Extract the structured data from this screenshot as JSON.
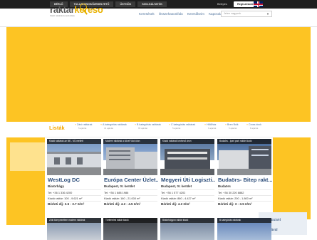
{
  "topbar": {
    "nav": [
      "BÉRLŐ",
      "TULAJDONOS/ÜZEMELTETŐ",
      "ÜGYNÖK",
      "SZOLGÁLTATÓK"
    ],
    "login": "Belépés",
    "register": "Regisztráció"
  },
  "header": {
    "logo_part1": "raktar",
    "logo_part2": "kereso",
    "logo_suffix": ".info",
    "tagline": "Kiadó raktárak keresőoldala",
    "nav": [
      "Keresések",
      "Összehasonlítás",
      "Keresőkeim",
      "Kapcsolat"
    ],
    "select_placeholder": "Jelen vagyunk"
  },
  "lists": {
    "title": "Listák",
    "categories": [
      {
        "label": "Záró raktárak",
        "count": "5 ajánlat"
      },
      {
        "label": "A kategóriás raktárak",
        "count": "31 ajánlat"
      },
      {
        "label": "B kategóriás raktárak",
        "count": "65 ajánlat"
      },
      {
        "label": "C kategóriás raktárak",
        "count": "5 ajánlat"
      },
      {
        "label": "Hűtőház",
        "count": "6 ajánlat"
      },
      {
        "label": "Bren Bulk",
        "count": "5 ajánlat"
      },
      {
        "label": "Cross dock",
        "count": "8 ajánlat"
      }
    ]
  },
  "cards": [
    {
      "tag": "Kiadó raktárak az M0 - M1 mellett",
      "name": "WestLog DC",
      "location": "Biatorbágy",
      "phone": "Tel: +36 1 336 4200",
      "area": "Kiadó raktár: 100 - 9.621 m²",
      "price": "Bérleti díj: 2.5 - 3.7 €/m²"
    },
    {
      "tag": "Modern raktárak a közel Váci úton",
      "name": "Európa Center Üzlet...",
      "location": "Budapest, IV. kerület",
      "phone": "Tel: +36 1 688 1986",
      "area": "Kiadó raktár: 160 - 21.000 m²",
      "price": "Bérleti díj: 4.2 - 4.5 €/m²"
    },
    {
      "tag": "Kiadó raktárak kedvező áron",
      "name": "Megyeri Úti Logiszti...",
      "location": "Budapest, IV. kerület",
      "phone": "Tel: +36 1 577 4202",
      "area": "Kiadó raktár: 860 - 4.427 m²",
      "price": "Bérleti díj: 4.2 €/m²"
    },
    {
      "tag": "Budaörs - Ipari park raktár kiadó",
      "name": "Budaörs- Bitep rakt...",
      "location": "Budaörs",
      "phone": "Tel: +36 30 220 8882",
      "area": "Kiadó raktár: 200 - 1.800 m²",
      "price": "Bérleti díj: 3 - 3.5 €/m²"
    }
  ],
  "bottom_cards": [
    "Zöld környezetben modern raktárak",
    "Történelmi raktár kiadó",
    "Biatorbágyon raktár kiadó",
    "B kategóriás raktárak"
  ],
  "side_right": {
    "line1": "Kinaszant",
    "line2": "irodával"
  },
  "colors": {
    "accent_yellow": "#fdc423",
    "brand_orange": "#f5a800",
    "link_blue": "#2c4d7a"
  }
}
